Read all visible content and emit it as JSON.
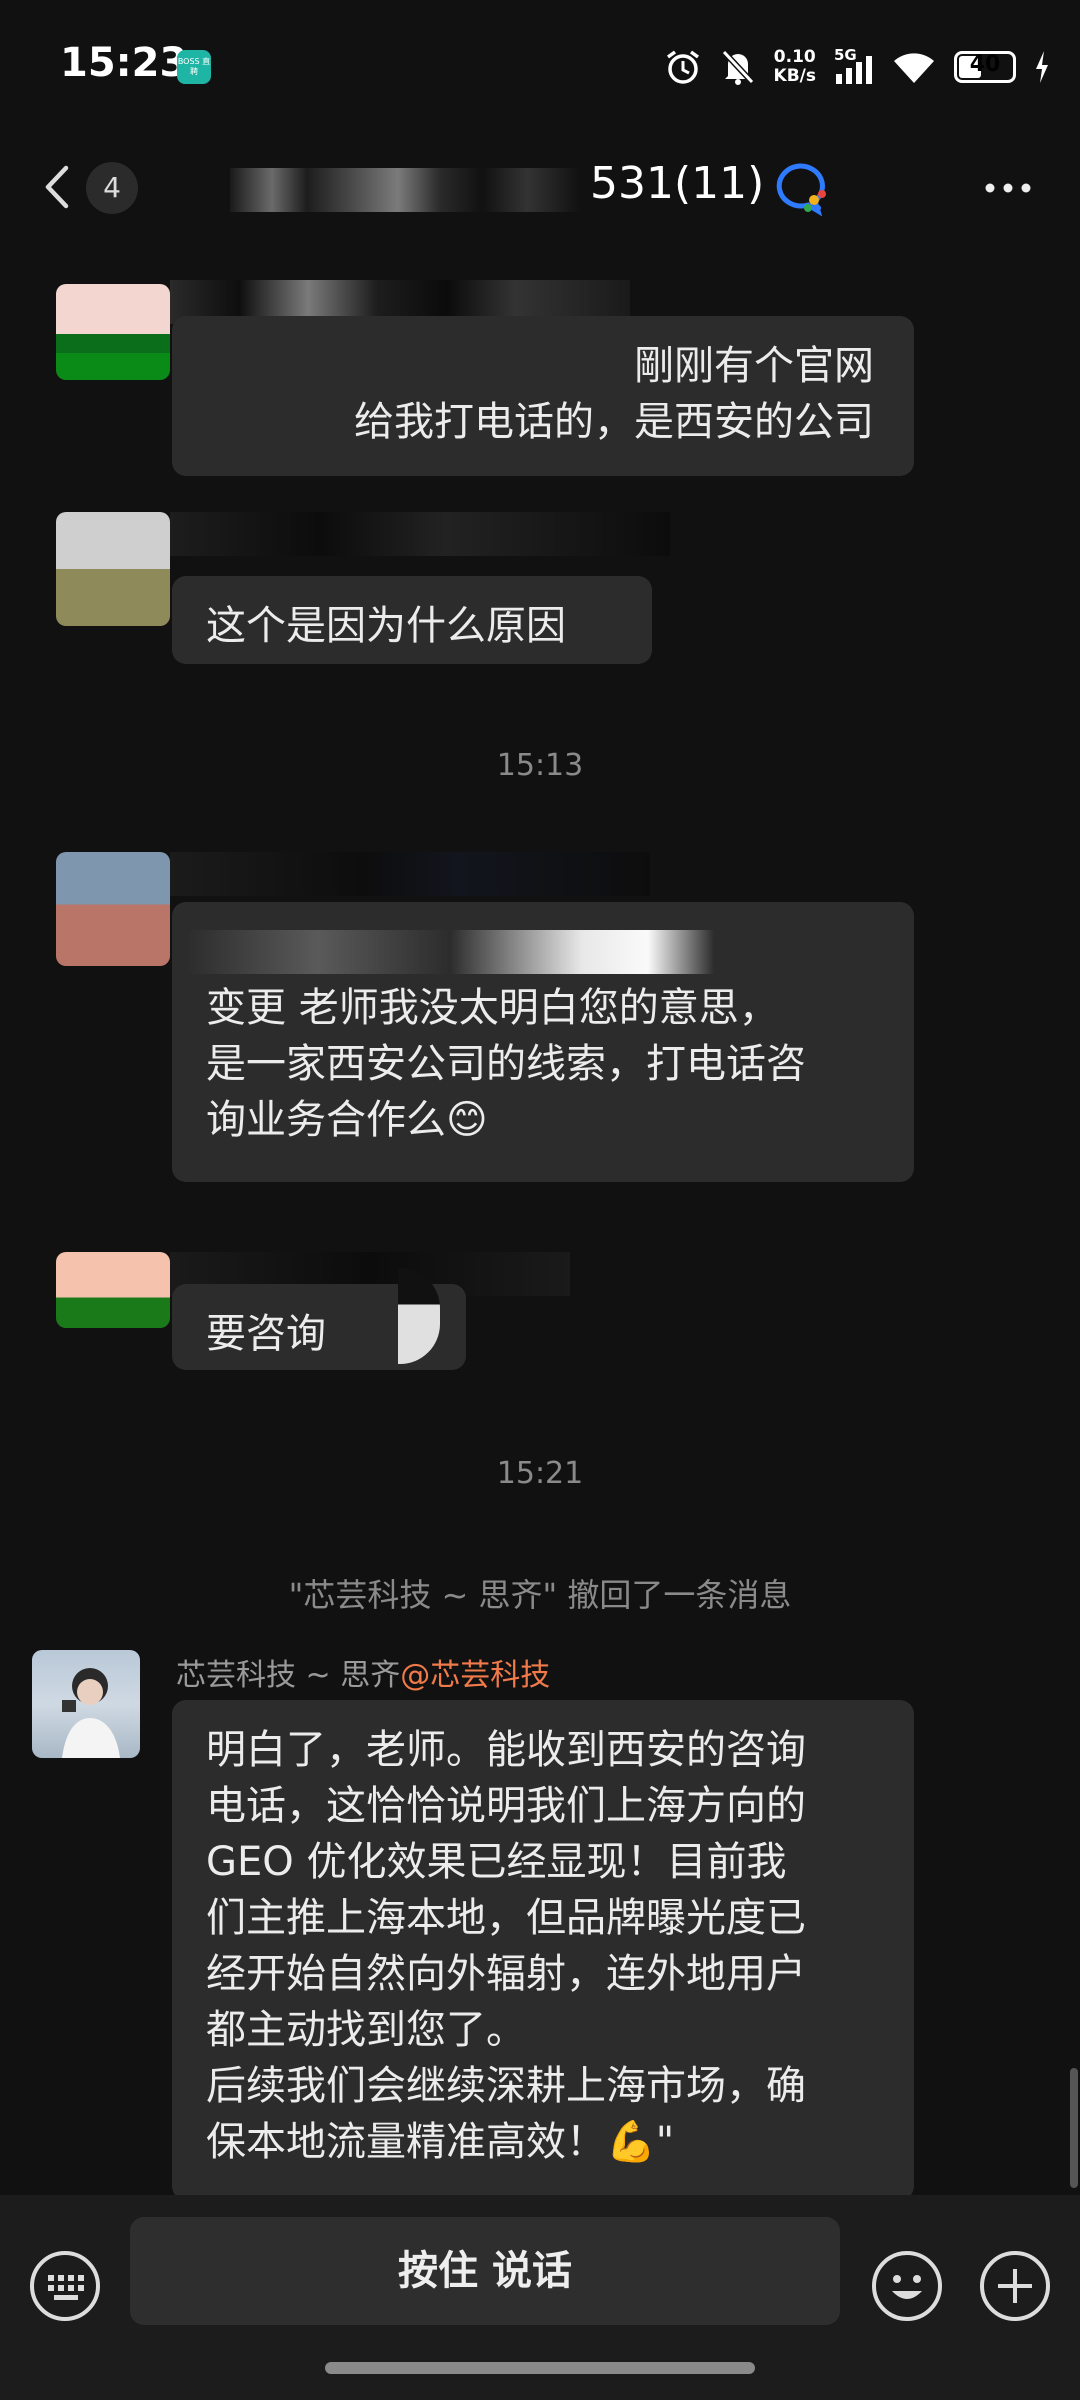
{
  "status_bar": {
    "time": "15:23",
    "app_badge": "BOSS\n直聘",
    "net_speed_value": "0.10",
    "net_speed_unit": "KB/s",
    "network": "5G",
    "battery": "40"
  },
  "header": {
    "unread_count": "4",
    "title_visible": "531(11)"
  },
  "messages": [
    {
      "type": "text",
      "text": "剛刚有个官网\n给我打电话的，是西安的公司"
    },
    {
      "type": "text",
      "text": "这个是因为什么原因"
    },
    {
      "type": "time",
      "text": "15:13"
    },
    {
      "type": "text",
      "text": "& \n变更 老师我没太明白您的意思，\n是一家西安公司的线索，打电话咨\n询业务合作么😊"
    },
    {
      "type": "text",
      "text": "要咨询"
    },
    {
      "type": "time",
      "text": "15:21"
    },
    {
      "type": "system",
      "text": "\"芯芸科技 ~ 思齐\" 撤回了一条消息"
    },
    {
      "type": "sender",
      "name": "芯芸科技 ~ 思齐",
      "mention": "@芯芸科技"
    },
    {
      "type": "text",
      "text": "明白了，老师。能收到西安的咨询\n电话，这恰恰说明我们上海方向的\nGEO 优化效果已经显现！目前我\n们主推上海本地，但品牌曝光度已\n经开始自然向外辐射，连外地用户\n都主动找到您了。\n后续我们会继续深耕上海市场，确\n保本地流量精准高效！💪\""
    }
  ],
  "bottom_bar": {
    "voice_label": "按住 说话"
  }
}
